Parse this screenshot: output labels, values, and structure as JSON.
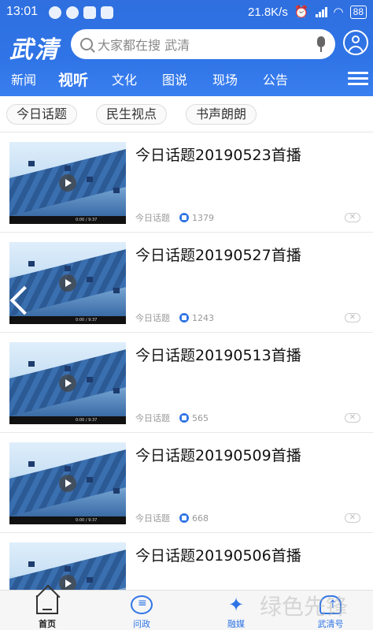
{
  "status": {
    "time": "13:01",
    "network_speed": "21.8K/s",
    "battery": "88"
  },
  "header": {
    "logo": "武清",
    "search_placeholder": "大家都在搜 武清"
  },
  "tabs": [
    {
      "label": "新闻"
    },
    {
      "label": "视听"
    },
    {
      "label": "文化"
    },
    {
      "label": "图说"
    },
    {
      "label": "现场"
    },
    {
      "label": "公告"
    }
  ],
  "chips": [
    {
      "label": "今日话题"
    },
    {
      "label": "民生视点"
    },
    {
      "label": "书声朗朗"
    }
  ],
  "items": [
    {
      "title": "今日话题20190523首播",
      "source": "今日话题",
      "likes": "1379"
    },
    {
      "title": "今日话题20190527首播",
      "source": "今日话题",
      "likes": "1243"
    },
    {
      "title": "今日话题20190513首播",
      "source": "今日话题",
      "likes": "565"
    },
    {
      "title": "今日话题20190509首播",
      "source": "今日话题",
      "likes": "668"
    },
    {
      "title": "今日话题20190506首播",
      "source": "",
      "likes": ""
    }
  ],
  "video_time": "0:00 / 9:37",
  "bottom_nav": [
    {
      "label": "首页"
    },
    {
      "label": "问政"
    },
    {
      "label": "融媒"
    },
    {
      "label": "武清号"
    }
  ],
  "watermark": "绿色先锋",
  "icons": [
    "search-icon",
    "mic-icon",
    "user-icon",
    "menu-icon",
    "play-icon",
    "like-icon",
    "close-icon",
    "back-arrow-icon",
    "home-icon",
    "chat-icon",
    "media-icon",
    "cloud-icon"
  ],
  "colors": {
    "brand_blue": "#2f74e6"
  }
}
